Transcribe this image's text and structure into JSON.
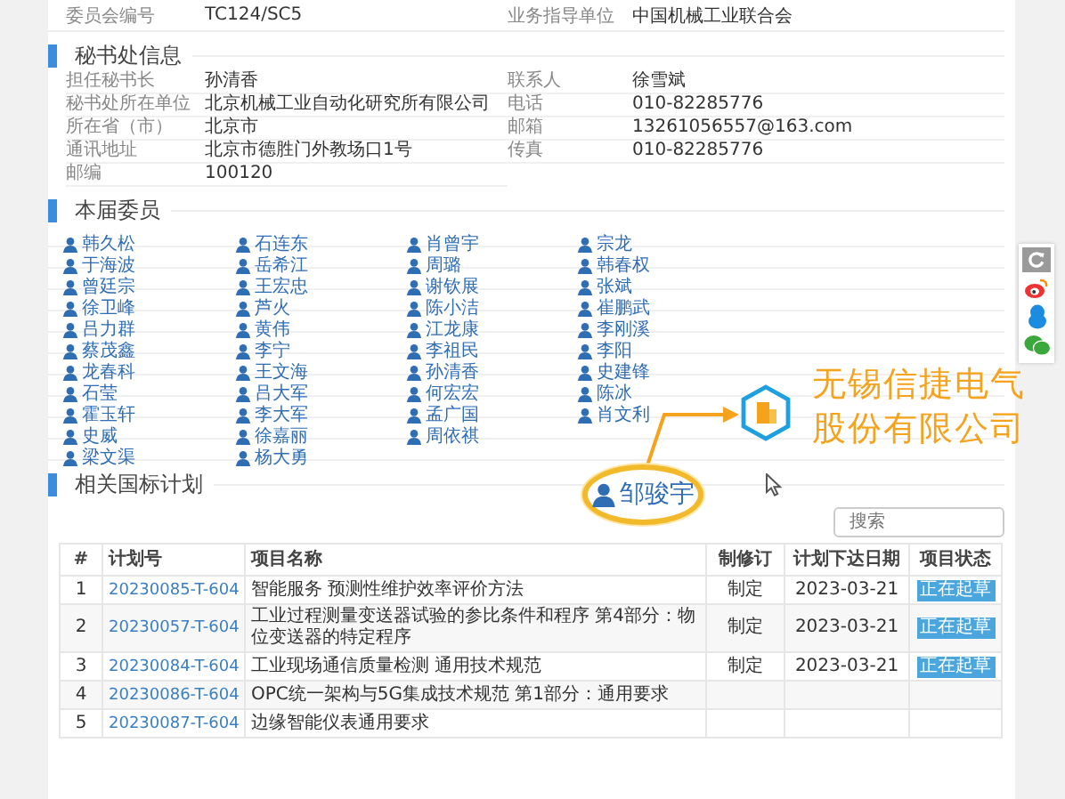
{
  "top_row": [
    {
      "label": "委员会编号",
      "value": "TC124/SC5"
    },
    {
      "label": "业务指导单位",
      "value": "中国机械工业联合会"
    }
  ],
  "secretariat": {
    "title": "秘书处信息",
    "fields": [
      {
        "label": "担任秘书长",
        "value": "孙清香"
      },
      {
        "label": "联系人",
        "value": "徐雪斌"
      },
      {
        "label": "秘书处所在单位",
        "value": "北京机械工业自动化研究所有限公司"
      },
      {
        "label": "电话",
        "value": "010-82285776"
      },
      {
        "label": "所在省（市）",
        "value": "北京市"
      },
      {
        "label": "邮箱",
        "value": "13261056557@163.com"
      },
      {
        "label": "通讯地址",
        "value": "北京市德胜门外教场口1号"
      },
      {
        "label": "传真",
        "value": "010-82285776"
      },
      {
        "label": "邮编",
        "value": "100120"
      }
    ]
  },
  "members": {
    "title": "本届委员",
    "rows": [
      [
        "韩久松",
        "石连东",
        "肖曾宇",
        "宗龙"
      ],
      [
        "于海波",
        "岳希江",
        "周璐",
        "韩春权"
      ],
      [
        "曾廷宗",
        "王宏忠",
        "谢钦展",
        "张斌"
      ],
      [
        "徐卫峰",
        "芦火",
        "陈小洁",
        "崔鹏武"
      ],
      [
        "吕力群",
        "黄伟",
        "江龙康",
        "李刚溪"
      ],
      [
        "蔡茂鑫",
        "李宁",
        "李祖民",
        "李阳"
      ],
      [
        "龙春科",
        "王文海",
        "孙清香",
        "史建锋"
      ],
      [
        "石莹",
        "吕大军",
        "何宏宏",
        "陈冰"
      ],
      [
        "霍玉轩",
        "李大军",
        "孟广国",
        "肖文利"
      ],
      [
        "史威",
        "徐嘉丽",
        "周依祺"
      ],
      [
        "梁文渠",
        "杨大勇"
      ]
    ]
  },
  "callout": {
    "name": "邹骏宇",
    "company_lines": [
      "无锡信捷电气",
      "股份有限公司"
    ]
  },
  "plans": {
    "title": "相关国标计划",
    "search": {
      "placeholder": "搜索"
    },
    "columns": [
      "#",
      "计划号",
      "项目名称",
      "制修订",
      "计划下达日期",
      "项目状态"
    ],
    "rows": [
      {
        "index": "1",
        "plan_no": "20230085-T-604",
        "name": "智能服务 预测性维护效率评价方法",
        "type": "制定",
        "date": "2023-03-21",
        "status": "正在起草"
      },
      {
        "index": "2",
        "plan_no": "20230057-T-604",
        "name": "工业过程测量变送器试验的参比条件和程序 第4部分：物位变送器的特定程序",
        "type": "制定",
        "date": "2023-03-21",
        "status": "正在起草"
      },
      {
        "index": "3",
        "plan_no": "20230084-T-604",
        "name": "工业现场通信质量检测 通用技术规范",
        "type": "制定",
        "date": "2023-03-21",
        "status": "正在起草"
      },
      {
        "index": "4",
        "plan_no": "20230086-T-604",
        "name": "OPC统一架构与5G集成技术规范 第1部分：通用要求"
      },
      {
        "index": "5",
        "plan_no": "20230087-T-604",
        "name": "边缘智能仪表通用要求"
      }
    ]
  }
}
